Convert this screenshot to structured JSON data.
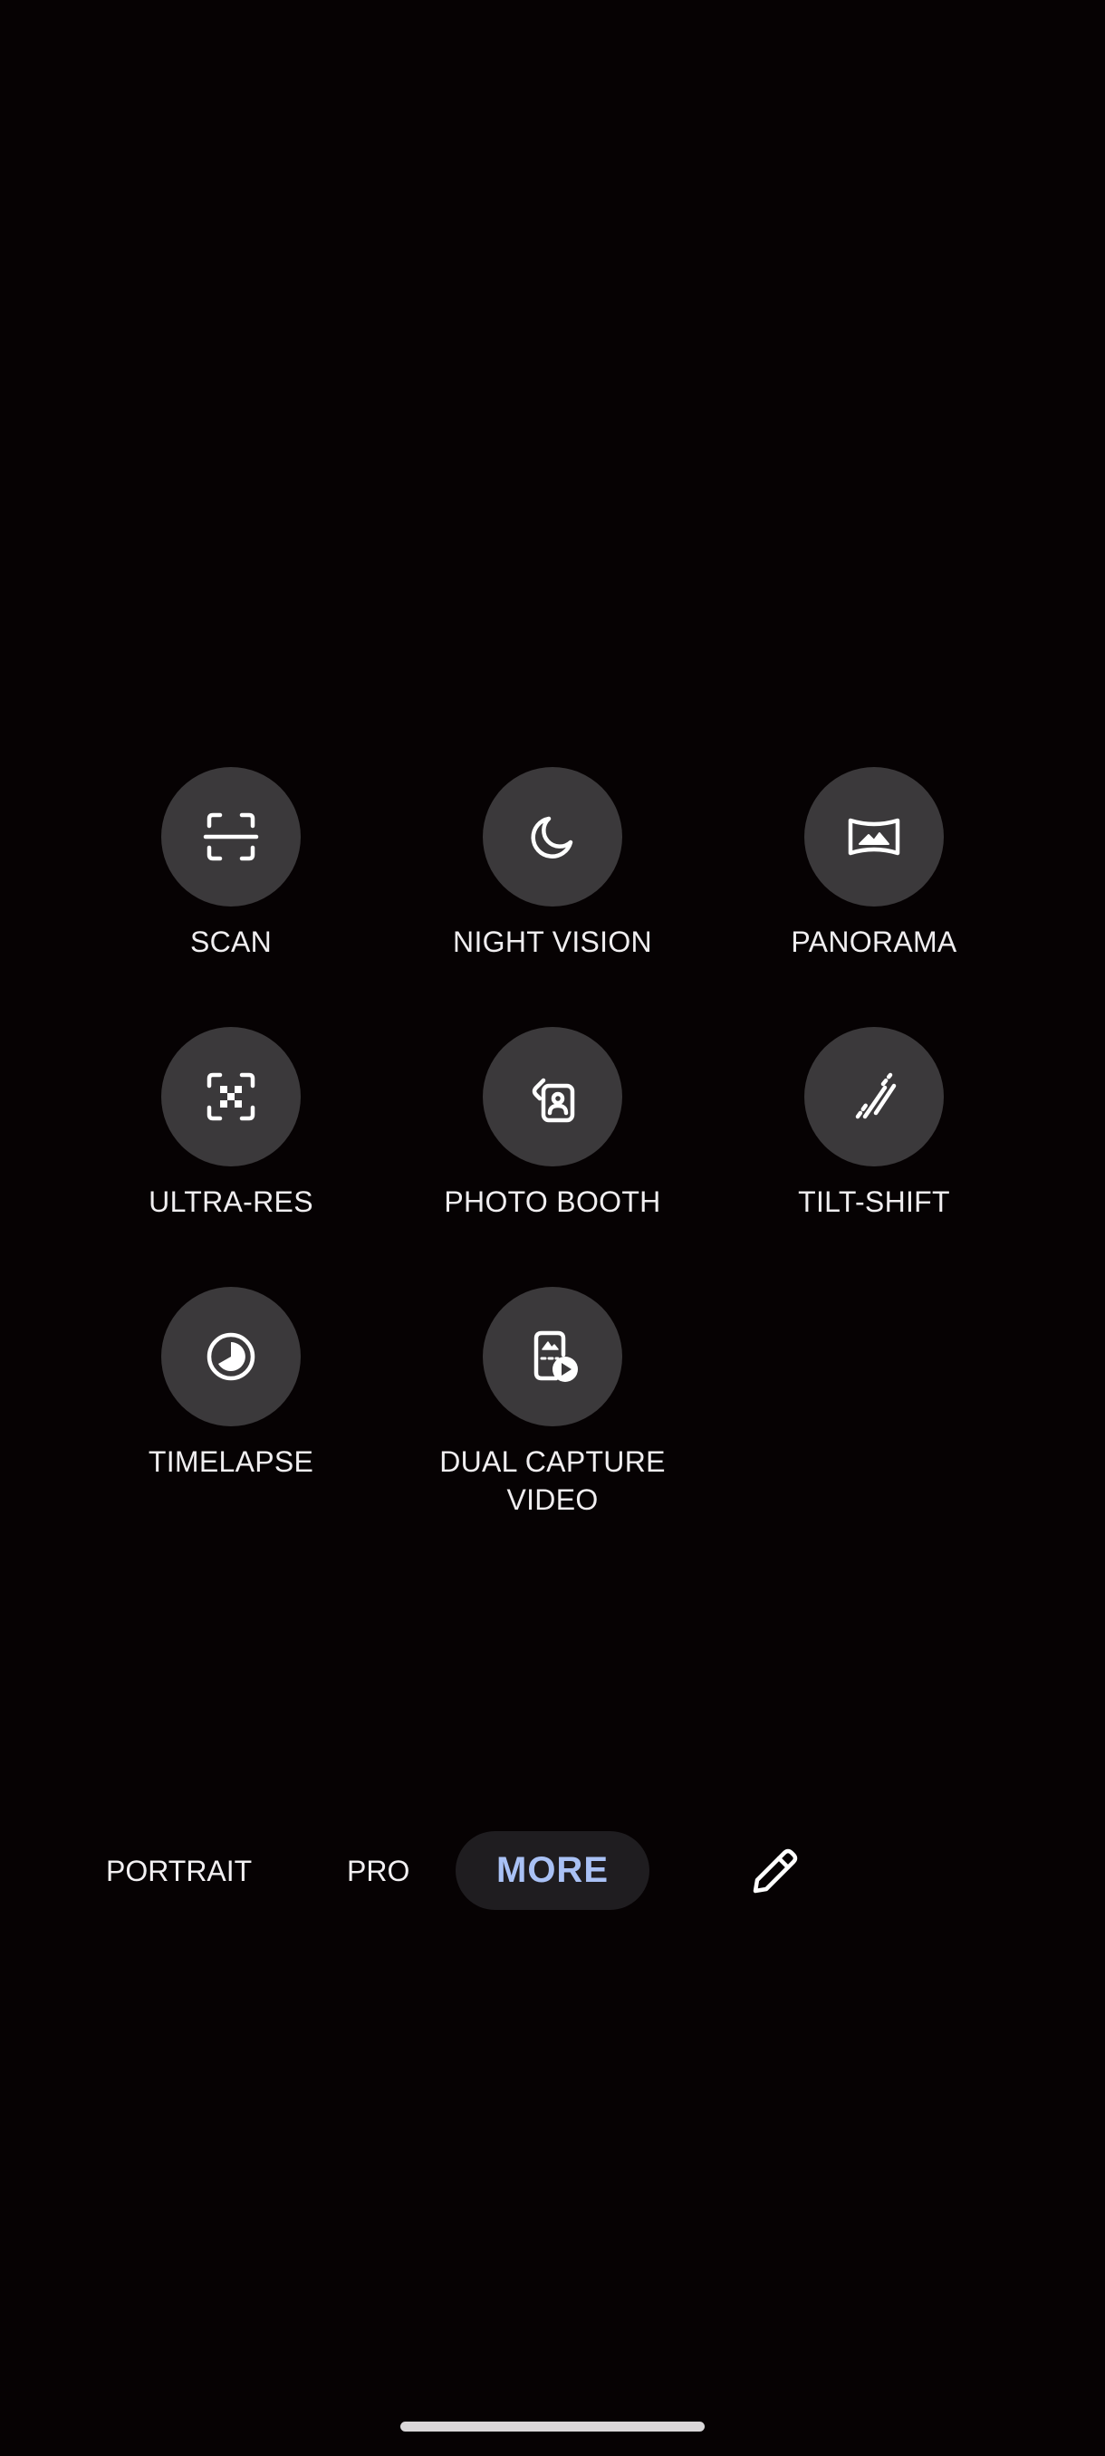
{
  "modes": [
    {
      "label": "SCAN",
      "icon": "scan-icon"
    },
    {
      "label": "NIGHT VISION",
      "icon": "moon-icon"
    },
    {
      "label": "PANORAMA",
      "icon": "panorama-icon"
    },
    {
      "label": "ULTRA-RES",
      "icon": "ultra-res-icon"
    },
    {
      "label": "PHOTO BOOTH",
      "icon": "photo-booth-icon"
    },
    {
      "label": "TILT-SHIFT",
      "icon": "tilt-shift-icon"
    },
    {
      "label": "TIMELAPSE",
      "icon": "timelapse-icon"
    },
    {
      "label": "DUAL CAPTURE\nVIDEO",
      "icon": "dual-capture-video-icon"
    }
  ],
  "bottom_bar": {
    "portrait_label": "PORTRAIT",
    "pro_label": "PRO",
    "more_label": "MORE",
    "edit_icon": "pencil-icon"
  },
  "colors": {
    "background": "#060203",
    "circle": "#3b393b",
    "active_tab_text": "#a9c1f5",
    "active_tab_pill": "#1f1d20"
  }
}
